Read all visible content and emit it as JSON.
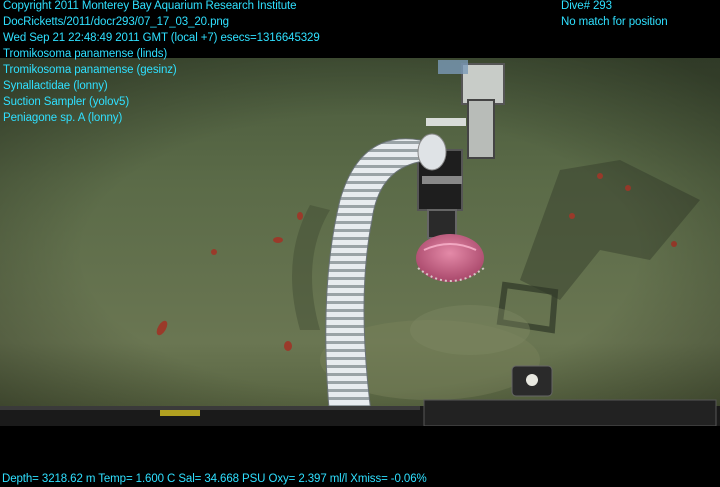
{
  "overlay": {
    "top_left_lines": [
      "Copyright 2011 Monterey Bay Aquarium Research Institute",
      "DocRicketts/2011/docr293/07_17_03_20.png",
      "Wed Sep 21 22:48:49 2011 GMT (local +7)  esecs=1316645329",
      "Tromikosoma panamense (linds)",
      "Tromikosoma panamense (gesinz)",
      "Synallactidae (lonny)",
      "Suction Sampler (yolov5)",
      "Peniagone sp. A (lonny)"
    ],
    "top_right_lines": [
      "Dive# 293",
      "No match for position"
    ],
    "bottom_line": "Depth= 3218.62 m  Temp= 1.600 C  Sal= 34.668 PSU  Oxy= 2.397 ml/l  Xmiss= -0.06%"
  },
  "colors": {
    "overlay_text": "#2fe0ff",
    "seafloor": "#5a6a48",
    "specimen": "#c85a7c"
  }
}
